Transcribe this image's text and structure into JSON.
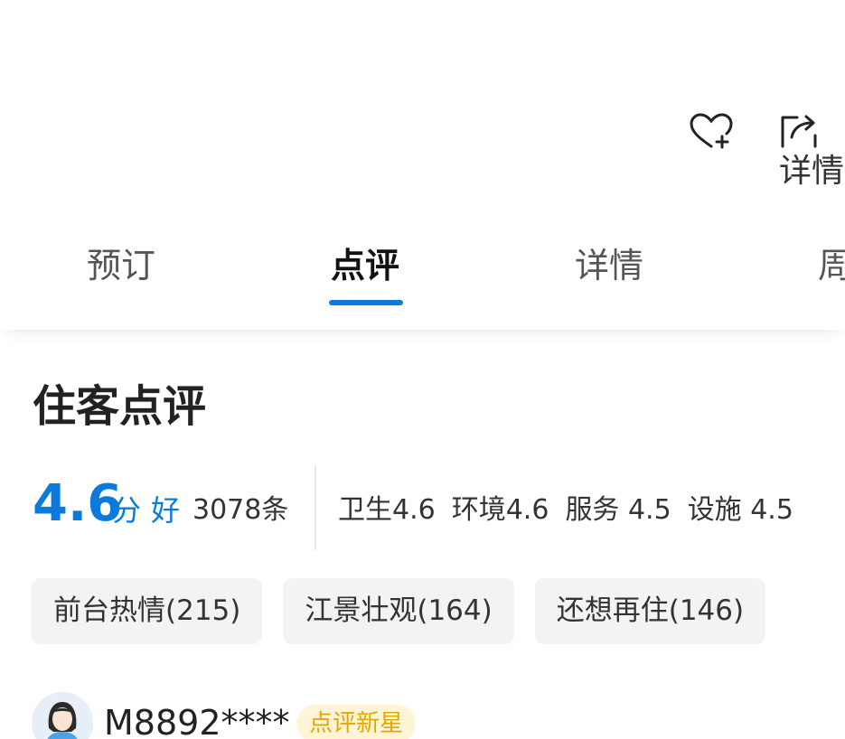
{
  "header": {
    "favorite_icon": "heart-plus-icon",
    "share_icon": "share-icon",
    "share_label": "详情"
  },
  "tabs": [
    {
      "label": "预订",
      "active": false
    },
    {
      "label": "点评",
      "active": true
    },
    {
      "label": "详情",
      "active": false
    },
    {
      "label": "周",
      "active": false
    }
  ],
  "reviews": {
    "title": "住客点评",
    "score": "4.6",
    "score_unit": "分",
    "rating_word": "好",
    "count": "3078条",
    "sub_scores": [
      {
        "text": "卫生4.6"
      },
      {
        "text": "环境4.6"
      },
      {
        "text": "服务 4.5"
      },
      {
        "text": "设施 4.5"
      }
    ],
    "tags": [
      {
        "label": "前台热情(215)"
      },
      {
        "label": "江景壮观(164)"
      },
      {
        "label": "还想再住(146)"
      }
    ],
    "first_review": {
      "username": "M8892****",
      "badge": "点评新星"
    }
  },
  "colors": {
    "accent": "#0a7bdc",
    "badge_bg": "#fff4d6",
    "badge_text": "#e0a800",
    "tag_bg": "#f3f3f3"
  }
}
